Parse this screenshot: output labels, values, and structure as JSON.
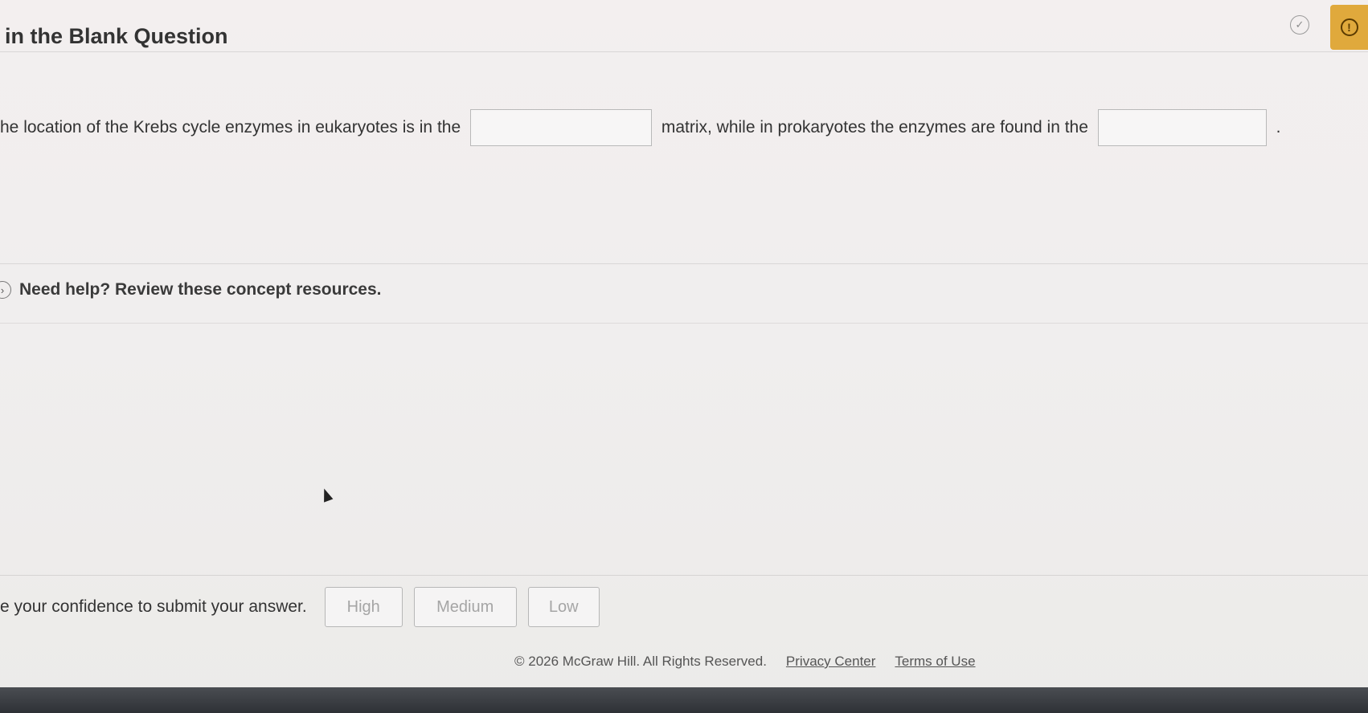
{
  "header": {
    "title": "in the Blank Question",
    "check_icon": "check-circle-icon",
    "alert_icon": "exclamation-circle-icon",
    "alert_color": "#e0a93c"
  },
  "question": {
    "part1": "he location of the Krebs cycle enzymes in eukaryotes is in the",
    "blank1_value": "",
    "part2": "matrix, while in prokaryotes the enzymes are found in the",
    "blank2_value": "",
    "part3": "."
  },
  "help": {
    "icon": "chevron-right-circle-icon",
    "text": "Need help? Review these concept resources."
  },
  "confidence": {
    "prompt": "e your confidence to submit your answer.",
    "buttons": [
      "High",
      "Medium",
      "Low"
    ]
  },
  "footer": {
    "copyright": "© 2026 McGraw Hill. All Rights Reserved.",
    "privacy": "Privacy Center",
    "terms": "Terms of Use"
  }
}
